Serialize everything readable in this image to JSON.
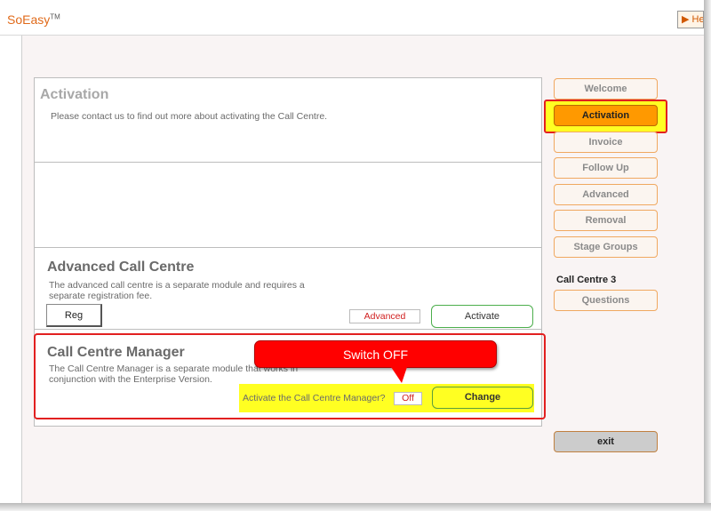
{
  "app": {
    "logo": "SoEasy",
    "logo_tm": "TM",
    "help_label": "▶ He"
  },
  "activation_panel": {
    "title": "Activation",
    "text": "Please contact us to find out more about activating the Call Centre."
  },
  "advanced_panel": {
    "title": "Advanced Call Centre",
    "text": "The advanced call centre is a separate module and requires a separate registration fee.",
    "reg_label": "Reg",
    "status": "Advanced",
    "activate_label": "Activate"
  },
  "manager_panel": {
    "title": "Call Centre Manager",
    "text": "The Call Centre Manager is a separate module that works in conjunction with the Enterprise Version.",
    "question": "Activate the Call Centre Manager?",
    "status": "Off",
    "change_label": "Change"
  },
  "callout": {
    "text": "Switch OFF"
  },
  "nav": {
    "items": [
      {
        "label": "Welcome"
      },
      {
        "label": "Activation"
      },
      {
        "label": "Invoice"
      },
      {
        "label": "Follow Up"
      },
      {
        "label": "Advanced"
      },
      {
        "label": "Removal"
      },
      {
        "label": "Stage Groups"
      }
    ],
    "section_title": "Call Centre 3",
    "section_items": [
      {
        "label": "Questions"
      }
    ],
    "active": "Activation",
    "exit_label": "exit"
  },
  "colors": {
    "accent": "#ff9900",
    "highlight": "#ffff22",
    "annotation": "#ff0000"
  }
}
